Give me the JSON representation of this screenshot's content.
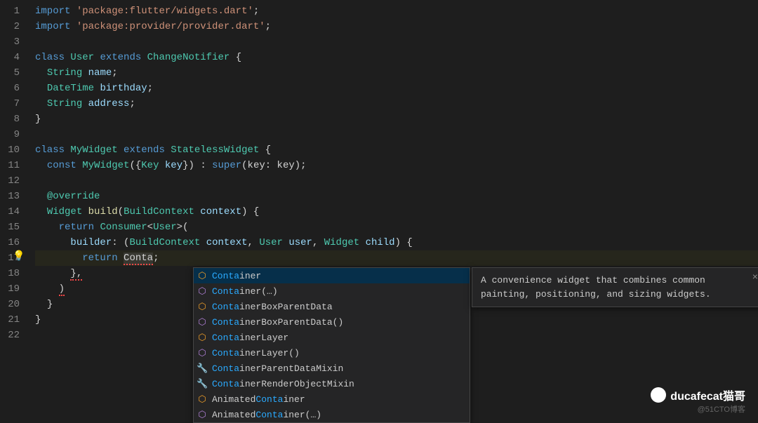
{
  "lineNumbers": [
    "1",
    "2",
    "3",
    "4",
    "5",
    "6",
    "7",
    "8",
    "9",
    "10",
    "11",
    "12",
    "13",
    "14",
    "15",
    "16",
    "17",
    "18",
    "19",
    "20",
    "21",
    "22"
  ],
  "code": {
    "l1_import": "import",
    "l1_pkg": "'package:flutter/widgets.dart'",
    "l2_import": "import",
    "l2_pkg": "'package:provider/provider.dart'",
    "l4_class": "class",
    "l4_name": "User",
    "l4_extends": "extends",
    "l4_parent": "ChangeNotifier",
    "l5_type": "String",
    "l5_name": "name",
    "l6_type": "DateTime",
    "l6_name": "birthday",
    "l7_type": "String",
    "l7_name": "address",
    "l10_class": "class",
    "l10_name": "MyWidget",
    "l10_extends": "extends",
    "l10_parent": "StatelessWidget",
    "l11_const": "const",
    "l11_ctor": "MyWidget",
    "l11_keytype": "Key",
    "l11_keyname": "key",
    "l11_super": "super",
    "l13_anno": "@override",
    "l14_type": "Widget",
    "l14_fn": "build",
    "l14_ptype": "BuildContext",
    "l14_pname": "context",
    "l15_return": "return",
    "l15_consumer": "Consumer",
    "l15_user": "User",
    "l16_builder": "builder",
    "l16_bc": "BuildContext",
    "l16_ctx": "context",
    "l16_usert": "User",
    "l16_user": "user",
    "l16_widget": "Widget",
    "l16_child": "child",
    "l17_return": "return",
    "l17_typed": "Conta"
  },
  "suggestions": [
    {
      "icon": "class",
      "match": "Conta",
      "rest": "iner"
    },
    {
      "icon": "method",
      "match": "Conta",
      "rest": "iner(…)"
    },
    {
      "icon": "class",
      "match": "Conta",
      "rest": "inerBoxParentData"
    },
    {
      "icon": "method",
      "match": "Conta",
      "rest": "inerBoxParentData()"
    },
    {
      "icon": "class",
      "match": "Conta",
      "rest": "inerLayer"
    },
    {
      "icon": "method",
      "match": "Conta",
      "rest": "inerLayer()"
    },
    {
      "icon": "interface",
      "match": "Conta",
      "rest": "inerParentDataMixin"
    },
    {
      "icon": "interface",
      "match": "Conta",
      "rest": "inerRenderObjectMixin"
    },
    {
      "icon": "class",
      "prefix": "Animated",
      "match": "Conta",
      "rest": "iner"
    },
    {
      "icon": "method",
      "prefix": "Animated",
      "match": "Conta",
      "rest": "iner(…)"
    }
  ],
  "doc": "A convenience widget that combines common painting, positioning, and sizing widgets.",
  "watermark": "ducafecat猫哥",
  "attribution": "@51CTO博客"
}
